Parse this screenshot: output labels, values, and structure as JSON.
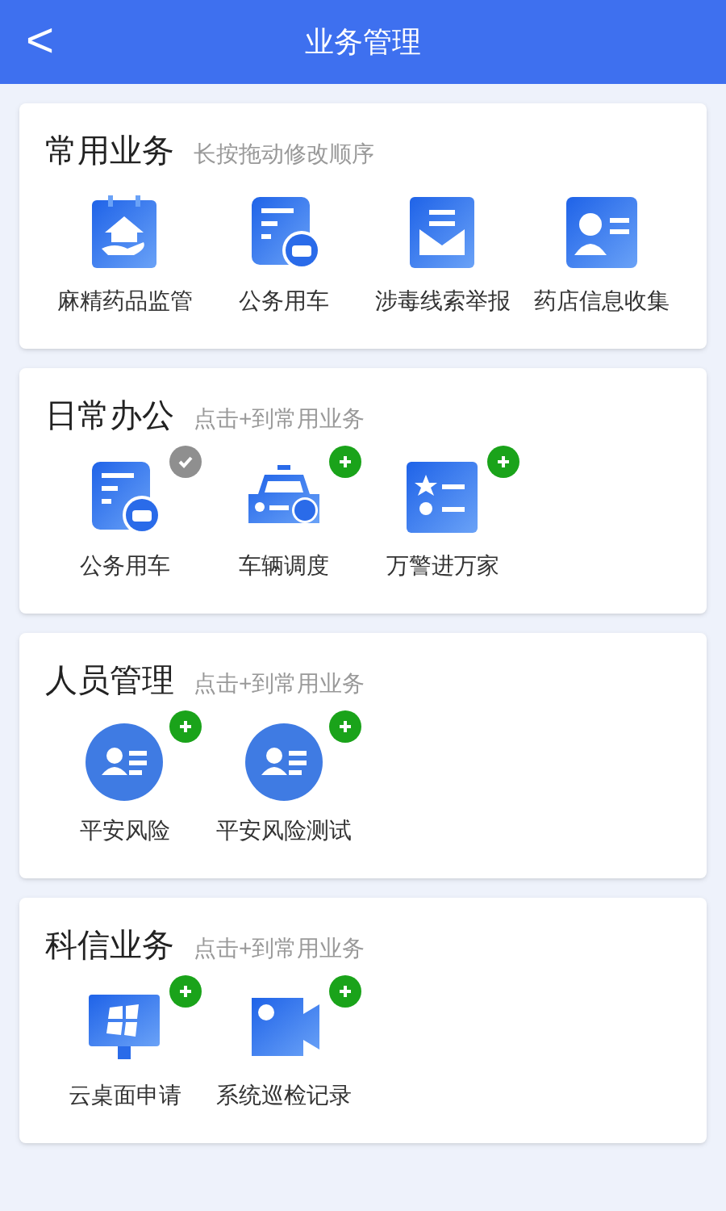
{
  "header": {
    "back": "<",
    "title": "业务管理"
  },
  "sections": [
    {
      "title": "常用业务",
      "hint": "长按拖动修改顺序",
      "items": [
        {
          "label": "麻精药品监管",
          "kind": "house"
        },
        {
          "label": "公务用车",
          "kind": "doc-car"
        },
        {
          "label": "涉毒线索举报",
          "kind": "mail"
        },
        {
          "label": "药店信息收集",
          "kind": "id-card"
        }
      ]
    },
    {
      "title": "日常办公",
      "hint": "点击+到常用业务",
      "items": [
        {
          "label": "公务用车",
          "kind": "doc-car",
          "added": true
        },
        {
          "label": "车辆调度",
          "kind": "police-car",
          "added": false
        },
        {
          "label": "万警进万家",
          "kind": "star-list",
          "added": false
        }
      ]
    },
    {
      "title": "人员管理",
      "hint": "点击+到常用业务",
      "items": [
        {
          "label": "平安风险",
          "kind": "person-circle",
          "added": false
        },
        {
          "label": "平安风险测试",
          "kind": "person-circle",
          "added": false
        }
      ]
    },
    {
      "title": "科信业务",
      "hint": "点击+到常用业务",
      "items": [
        {
          "label": "云桌面申请",
          "kind": "monitor",
          "added": false
        },
        {
          "label": "系统巡检记录",
          "kind": "video",
          "added": false
        }
      ]
    }
  ]
}
